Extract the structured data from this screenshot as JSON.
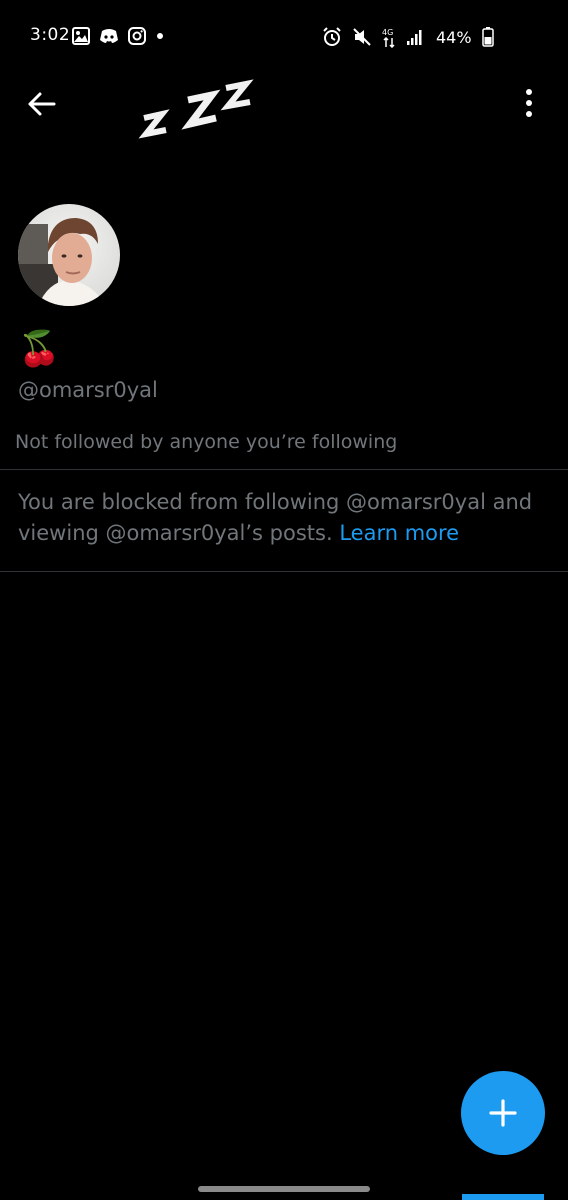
{
  "status_bar": {
    "time": "3:02",
    "battery": "44%",
    "left_icons": [
      "gallery-icon",
      "discord-icon",
      "instagram-icon",
      "notification-dot-icon"
    ],
    "right_icons": [
      "alarm-icon",
      "mute-icon",
      "data-transfer-icon",
      "signal-icon",
      "battery-icon"
    ]
  },
  "nav": {
    "back_icon": "arrow-left-icon",
    "more_icon": "vertical-dots-icon"
  },
  "profile": {
    "display_name": "🍒",
    "handle": "@omarsr0yal",
    "followers_note": "Not followed by anyone you’re following"
  },
  "blocked": {
    "message": "You are blocked from following @omarsr0yal and viewing @omarsr0yal’s posts. ",
    "link": "Learn more"
  },
  "fab": {
    "icon": "plus-icon"
  },
  "colors": {
    "background": "#000000",
    "accent": "#1d9bf0",
    "secondary_text": "#71767b",
    "divider": "#2f3336"
  }
}
